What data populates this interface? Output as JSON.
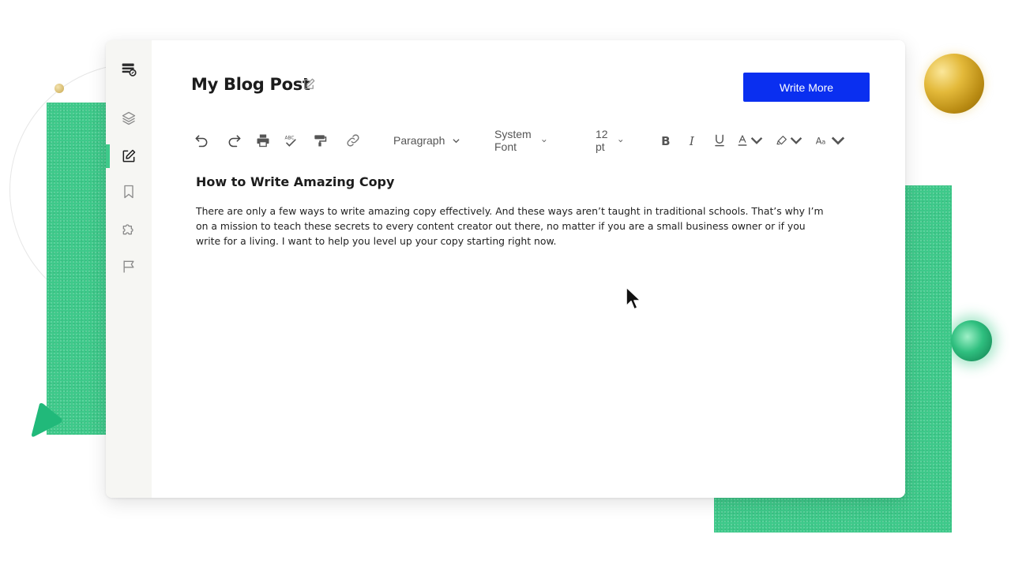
{
  "document": {
    "title": "My Blog Post",
    "heading": "How to Write Amazing Copy",
    "body": "There are only a few ways to write amazing copy effectively. And these ways aren’t taught in traditional schools. That’s why I’m on a mission to teach these secrets to every content creator out there, no matter if you are a small business owner or if you write for a living. I want to help you level up your copy starting right now."
  },
  "actions": {
    "write_more_label": "Write More"
  },
  "toolbar": {
    "paragraph_style": "Paragraph",
    "font_family": "System Font",
    "font_size": "12 pt",
    "tools": [
      "undo-icon",
      "redo-icon",
      "print-icon",
      "spellcheck-icon",
      "format-painter-icon",
      "link-icon",
      "bold-icon",
      "italic-icon",
      "underline-icon",
      "text-color-icon",
      "highlight-icon",
      "text-case-icon"
    ]
  },
  "sidebar": {
    "items": [
      "logo-icon",
      "layers-icon",
      "edit-icon",
      "bookmark-icon",
      "puzzle-icon",
      "flag-icon"
    ],
    "active": "edit-icon"
  },
  "colors": {
    "accent_green": "#3ec98a",
    "button_blue": "#0a2ff0",
    "sidebar_bg": "#f6f6f3"
  }
}
